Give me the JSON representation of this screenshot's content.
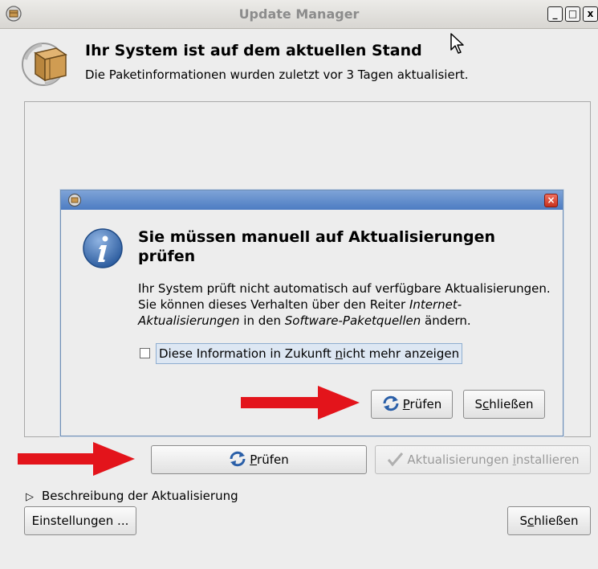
{
  "window": {
    "title": "Update Manager",
    "controls": {
      "minimize": "_",
      "maximize": "□",
      "close": "x"
    }
  },
  "header": {
    "title": "Ihr System ist auf dem aktuellen Stand",
    "subtitle": "Die Paketinformationen wurden zuletzt vor 3 Tagen aktualisiert."
  },
  "dialog": {
    "close": "×",
    "title": "Sie müssen manuell auf Aktualisierungen prüfen",
    "body_part1": "Ihr System prüft nicht automatisch auf verfügbare Aktualisierungen. Sie können dieses Verhalten über den Reiter ",
    "body_italic1": "Internet-Aktualisierungen",
    "body_part2": " in den ",
    "body_italic2": "Software-Paketquellen",
    "body_part3": " ändern.",
    "checkbox": {
      "label_before": "Diese Information in Zukunft ",
      "label_mnemonic": "n",
      "label_after": "icht mehr anzeigen",
      "checked": false
    },
    "check_button": {
      "mnemonic": "P",
      "rest": "rüfen"
    },
    "close_button": {
      "before": "S",
      "mnemonic": "c",
      "rest": "hließen"
    }
  },
  "main": {
    "check_button": {
      "mnemonic": "P",
      "rest": "rüfen"
    },
    "install_button": {
      "before": "Aktualisierungen ",
      "mnemonic": "i",
      "rest": "nstallieren",
      "enabled": false
    },
    "expander": {
      "label": "Beschreibung der Aktualisierung",
      "expanded": false
    },
    "settings_button": "Einstellungen ...",
    "close_button": {
      "before": "S",
      "mnemonic": "c",
      "rest": "hließen"
    }
  },
  "colors": {
    "annotation_arrow": "#e3141b",
    "dialog_titlebar": "#5a86c8",
    "info_icon": "#3a6fb5"
  }
}
